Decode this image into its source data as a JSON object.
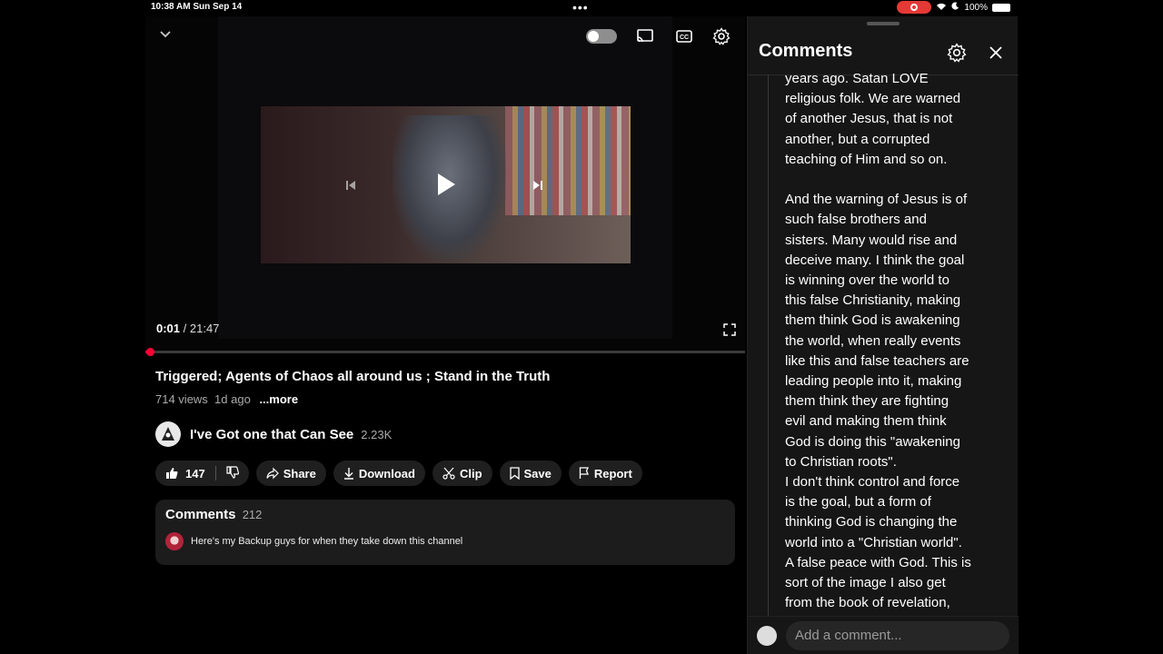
{
  "status_bar": {
    "time": "10:38 AM  Sun Sep 14",
    "dots": "•••",
    "battery": "100%"
  },
  "player": {
    "current_time": "0:01",
    "duration": "/ 21:47",
    "progress_fraction": 0.001
  },
  "video": {
    "title": "Triggered; Agents of Chaos all around us ; Stand in the Truth",
    "views": "714 views",
    "age": "1d ago",
    "more_label": "...more"
  },
  "channel": {
    "name": "I've Got one that Can See",
    "subscribers": "2.23K"
  },
  "actions": {
    "likes": "147",
    "share": "Share",
    "download": "Download",
    "clip": "Clip",
    "save": "Save",
    "report": "Report"
  },
  "comments_card": {
    "label": "Comments",
    "count": "212",
    "first_comment": "Here's my Backup guys for when they take down this channel"
  },
  "comments_panel": {
    "title": "Comments",
    "text": "years ago. Satan LOVE\nreligious folk. We are warned\nof another Jesus, that is not\nanother, but a corrupted\nteaching of Him and so on.\n\nAnd the warning of Jesus is of\nsuch false brothers and\nsisters. Many would rise and\ndeceive many. I think the goal\nis winning over the world to\nthis false Christianity, making\nthem think God is awakening\nthe world, when really events\nlike this and false teachers are\nleading people into it, making\nthem think they are fighting\nevil and making them think\nGod is doing this \"awakening\nto Christian roots\".\nI don't think control and force\nis the goal, but a form of\nthinking God is changing the\nworld into a \"Christian world\".\nA false peace with God. This is\nsort of the image I also get\nfrom the book of revelation,",
    "add_placeholder": "Add a comment..."
  },
  "colors": {
    "accent": "#ff0033",
    "recording": "#e53935"
  }
}
